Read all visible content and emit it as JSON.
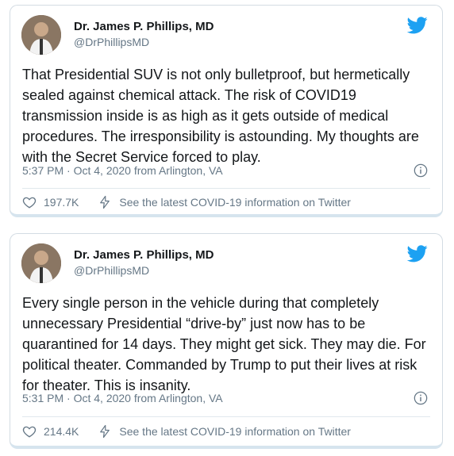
{
  "tweets": [
    {
      "name": "Dr. James P. Phillips, MD",
      "handle": "@DrPhillipsMD",
      "text": "That Presidential SUV is not only bulletproof, but hermetically sealed against chemical attack. The risk of COVID19 transmission inside is as high as it gets outside of medical procedures. The irresponsibility is astounding. My thoughts are with the Secret Service forced to play.",
      "timestamp": "5:37 PM · Oct 4, 2020 from Arlington, VA",
      "likes": "197.7K",
      "covid_link": "See the latest COVID-19 information on Twitter"
    },
    {
      "name": "Dr. James P. Phillips, MD",
      "handle": "@DrPhillipsMD",
      "text": "Every single person in the vehicle during that completely unnecessary Presidential “drive-by” just now has to be quarantined for 14 days. They might get sick. They may die. For political theater. Commanded by Trump to put their lives at risk for theater. This is insanity.",
      "timestamp": "5:31 PM · Oct 4, 2020 from Arlington, VA",
      "likes": "214.4K",
      "covid_link": "See the latest COVID-19 information on Twitter"
    }
  ],
  "colors": {
    "twitter_blue": "#1da1f2",
    "text_primary": "#14171a",
    "text_secondary": "#657786"
  },
  "icons": [
    "twitter-bird-icon",
    "info-icon",
    "heart-icon",
    "lightning-icon"
  ]
}
